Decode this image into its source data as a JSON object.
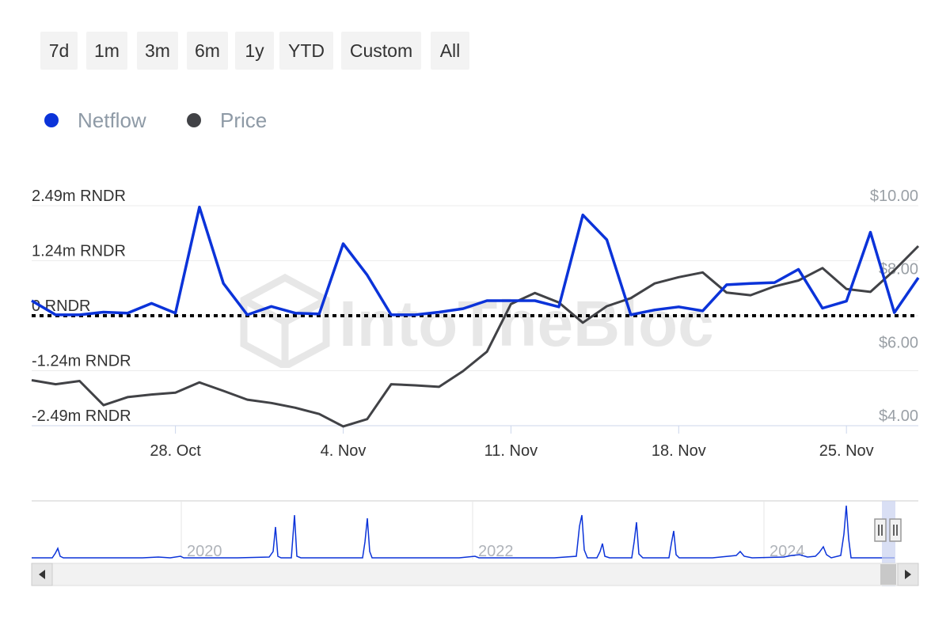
{
  "range_buttons": [
    "7d",
    "1m",
    "3m",
    "6m",
    "1y",
    "YTD",
    "Custom",
    "All"
  ],
  "legend": [
    {
      "label": "Netflow",
      "color": "#0b33d9"
    },
    {
      "label": "Price",
      "color": "#414246"
    }
  ],
  "watermark": "IntoTheBlock",
  "chart_data": {
    "type": "line",
    "x_tick_labels": [
      "28. Oct",
      "4. Nov",
      "11. Nov",
      "18. Nov",
      "25. Nov"
    ],
    "y_left_ticks": [
      "2.49m RNDR",
      "1.24m RNDR",
      "0 RNDR",
      "-1.24m RNDR",
      "-2.49m RNDR"
    ],
    "y_right_ticks": [
      "$10.00",
      "$8.00",
      "$6.00",
      "$4.00"
    ],
    "ylim_left": [
      -2.49,
      2.49
    ],
    "ylim_right": [
      4,
      10
    ],
    "x": [
      0,
      1,
      2,
      3,
      4,
      5,
      6,
      7,
      8,
      9,
      10,
      11,
      12,
      13,
      14,
      15,
      16,
      17,
      18,
      19,
      20,
      21,
      22,
      23,
      24,
      25,
      26,
      27,
      28,
      29,
      30,
      31,
      32,
      33,
      34,
      35,
      36,
      37
    ],
    "series": [
      {
        "name": "Netflow",
        "axis": "left",
        "color": "#0b33d9",
        "values": [
          0.34,
          0.02,
          0.02,
          0.08,
          0.06,
          0.28,
          0.06,
          2.46,
          0.73,
          0.02,
          0.21,
          0.06,
          0.04,
          1.63,
          0.92,
          0.02,
          0.02,
          0.08,
          0.16,
          0.34,
          0.34,
          0.34,
          0.2,
          2.28,
          1.72,
          0.02,
          0.13,
          0.2,
          0.11,
          0.7,
          0.73,
          0.75,
          1.05,
          0.17,
          0.33,
          1.89,
          0.07,
          0.86
        ]
      },
      {
        "name": "Price",
        "axis": "right",
        "color": "#414246",
        "values": [
          5.24,
          5.13,
          5.22,
          4.56,
          4.78,
          4.85,
          4.9,
          5.18,
          4.95,
          4.71,
          4.62,
          4.49,
          4.32,
          3.98,
          4.18,
          5.13,
          5.1,
          5.06,
          5.49,
          6.02,
          7.32,
          7.62,
          7.36,
          6.81,
          7.26,
          7.48,
          7.88,
          8.05,
          8.18,
          7.63,
          7.56,
          7.8,
          7.96,
          8.3,
          7.73,
          7.65,
          8.24,
          8.9
        ]
      }
    ],
    "zero_line": {
      "axis": "left",
      "value": 0,
      "style": "dotted"
    },
    "grid": true,
    "legend_position": "top-left"
  },
  "navigator": {
    "year_labels": [
      "2020",
      "2022",
      "2024"
    ],
    "scroll_left_icon": "arrow-left-icon",
    "scroll_right_icon": "arrow-right-icon",
    "handle_icon": "drag-handle-icon"
  }
}
